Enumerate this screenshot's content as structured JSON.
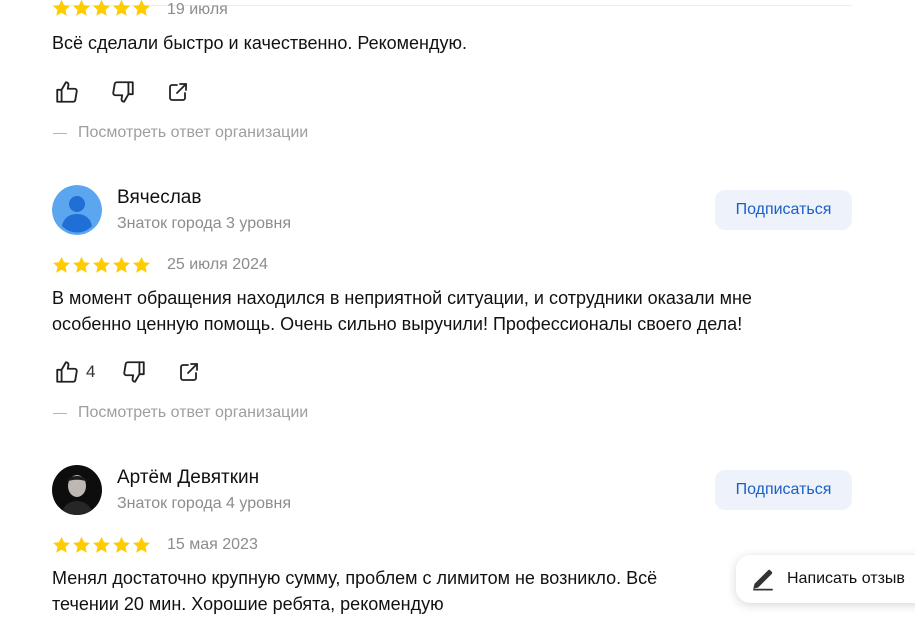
{
  "reviews": [
    {
      "rating": 5,
      "date": "19 июля",
      "text": "Всё сделали быстро и качественно. Рекомендую.",
      "likes": "",
      "org_reply_link": "Посмотреть ответ организации"
    },
    {
      "author": {
        "name": "Вячеслав",
        "level": "Знаток города 3 уровня",
        "avatar": "default-avatar-icon"
      },
      "subscribe_label": "Подписаться",
      "rating": 5,
      "date": "25 июля 2024",
      "text_lines": [
        "В момент обращения находился в неприятной ситуации, и сотрудники оказали мне",
        "особенно ценную помощь. Очень сильно выручили! Профессионалы своего дела!"
      ],
      "likes": "4",
      "org_reply_link": "Посмотреть ответ организации"
    },
    {
      "author": {
        "name": "Артём Девяткин",
        "level": "Знаток города 4 уровня",
        "avatar": "user-photo"
      },
      "subscribe_label": "Подписаться",
      "rating": 5,
      "date": "15 мая 2023",
      "text_lines": [
        "Менял достаточно крупную сумму, проблем с лимитом не возникло. Всё",
        "течении 20 мин. Хорошие ребята, рекомендую"
      ]
    }
  ],
  "fab": {
    "label": "Написать отзыв",
    "icon": "pencil-icon"
  },
  "colors": {
    "star": "#ffcc00",
    "link": "#1a5fc9",
    "button_bg": "#eef3fb",
    "muted": "#8c8c8c",
    "avatar_bg": "#5ba6ee",
    "avatar_fg": "#1f6fd6"
  }
}
